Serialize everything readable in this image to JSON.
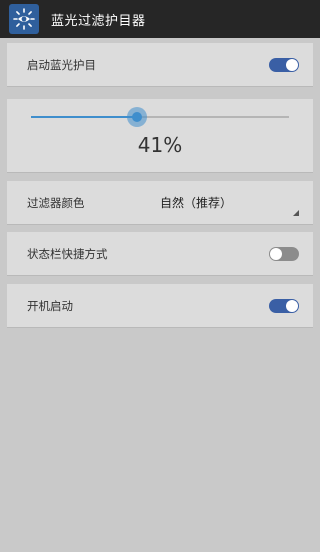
{
  "app": {
    "title": "蓝光过滤护目器",
    "icon": "eye-sun-icon"
  },
  "settings": {
    "enable_filter": {
      "label": "启动蓝光护目",
      "on": true
    },
    "intensity": {
      "value": 0.41,
      "value_label": "41%"
    },
    "filter_color": {
      "label": "过滤器颜色",
      "selected": "自然（推荐）"
    },
    "status_bar_shortcut": {
      "label": "状态栏快捷方式",
      "on": false
    },
    "start_on_boot": {
      "label": "开机启动",
      "on": true
    }
  },
  "colors": {
    "accent": "#3f8ecc",
    "toggle_on": "#3a5fa5",
    "toggle_off": "#8c8c8c",
    "appbar": "#262626",
    "background": "#c9c9c9",
    "card": "#dcdcdc"
  }
}
